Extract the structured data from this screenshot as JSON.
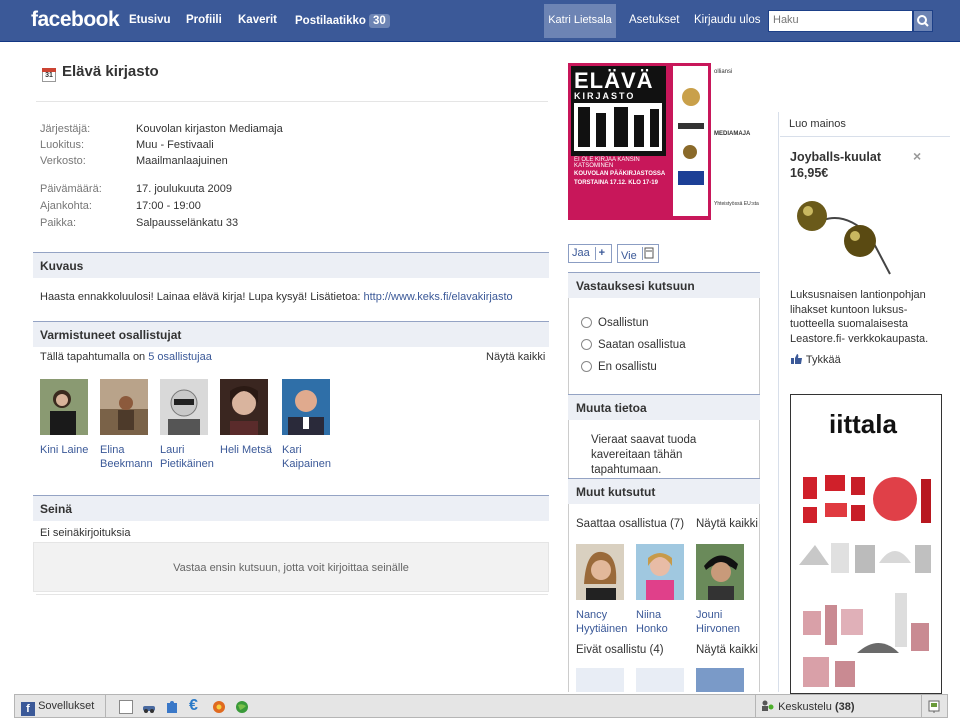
{
  "header": {
    "logo": "facebook",
    "nav": [
      "Etusivu",
      "Profiili",
      "Kaverit",
      "Postilaatikko"
    ],
    "inbox_count": "30",
    "user": "Katri Lietsala",
    "settings": "Asetukset",
    "logout": "Kirjaudu ulos",
    "search_placeholder": "Haku"
  },
  "event": {
    "title": "Elävä kirjasto",
    "calendar_day": "31",
    "info": [
      {
        "label": "Järjestäjä:",
        "value": "Kouvolan kirjaston Mediamaja",
        "link": true
      },
      {
        "label": "Luokitus:",
        "value": "Muu - Festivaali",
        "link": true
      },
      {
        "label": "Verkosto:",
        "value": "Maailmanlaajuinen",
        "link": false
      },
      {
        "label": "Päivämäärä:",
        "value": "17. joulukuuta 2009",
        "link": false
      },
      {
        "label": "Ajankohta:",
        "value": "17:00 - 19:00",
        "link": false
      },
      {
        "label": "Paikka:",
        "value": "Salpausselänkatu 33",
        "link": false
      }
    ]
  },
  "description": {
    "heading": "Kuvaus",
    "text": "Haasta ennakkoluulosi! Lainaa elävä kirja! Lupa kysyä! Lisätietoa: ",
    "url": "http://www.keks.fi/elavakirjasto"
  },
  "confirmed": {
    "heading": "Varmistuneet osallistujat",
    "summary": "Tällä tapahtumalla on ",
    "count_link": "5 osallistujaa",
    "see_all": "Näytä kaikki",
    "people": [
      {
        "name": "Kini Laine"
      },
      {
        "name": "Elina Beekmann"
      },
      {
        "name": "Lauri Pietikäinen"
      },
      {
        "name": "Heli Metsä"
      },
      {
        "name": "Kari Kaipainen"
      }
    ]
  },
  "wall": {
    "heading": "Seinä",
    "empty": "Ei seinäkirjoituksia",
    "prompt": "Vastaa ensin kutsuun, jotta voit kirjoittaa seinälle"
  },
  "poster": {
    "title": "ELÄVÄ",
    "subtitle": "KIRJASTO",
    "tagline": "EI OLE KIRJAA KANSIN KATSOMINEN",
    "location": "KOUVOLAN PÄÄKIRJASTOSSA",
    "time": "TORSTAINA 17.12. KLO 17-19",
    "logos": [
      "olliansi",
      "MEDIAMAJA",
      "Yhteistyössä EU:sta"
    ]
  },
  "share": {
    "share_label": "Jaa",
    "view_label": "Vie"
  },
  "rsvp": {
    "heading": "Vastauksesi kutsuun",
    "options": [
      "Osallistun",
      "Saatan osallistua",
      "En osallistu"
    ]
  },
  "other_info": {
    "heading": "Muuta tietoa",
    "text": "Vieraat saavat tuoda kavereitaan tähän tapahtumaan."
  },
  "others": {
    "heading": "Muut kutsutut",
    "maybe_label": "Saattaa osallistua (7)",
    "maybe_see_all": "Näytä kaikki",
    "maybe_people": [
      {
        "name": "Nancy Hyytiäinen"
      },
      {
        "name": "Niina Honko"
      },
      {
        "name": "Jouni Hirvonen"
      }
    ],
    "no_label": "Eivät osallistu (4)",
    "no_see_all": "Näytä kaikki"
  },
  "ads": {
    "create_ad": "Luo mainos",
    "title": "Joyballs-kuulat 16,95€",
    "close": "×",
    "body": "Luksusnaisen lantionpohjan lihakset kuntoon luksus-tuotteella suomalaisesta Leastore.fi- verkkokaupasta.",
    "like": "Tykkää",
    "brand": "iittala"
  },
  "chatbar": {
    "apps": "Sovellukset",
    "chat": "Keskustelu",
    "chat_count": "(38)"
  },
  "colors": {
    "brand": "#3b5998",
    "header_bg": "#eceff5",
    "poster": "#c8175a"
  }
}
